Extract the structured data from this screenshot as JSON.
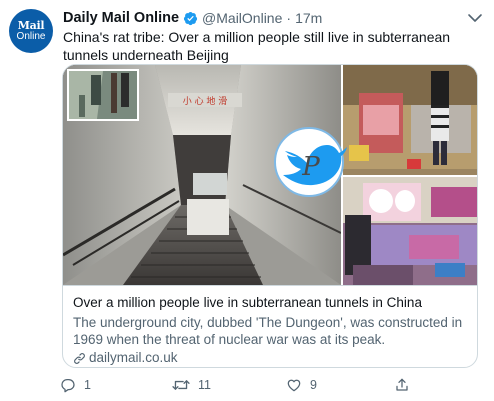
{
  "tweet": {
    "avatar": {
      "line1": "Mail",
      "line2": "Online"
    },
    "author_name": "Daily Mail Online",
    "handle": "@MailOnline",
    "separator": "·",
    "time": "17m",
    "text": "China's rat tribe: Over a million people still live in subterranean tunnels underneath Beijing",
    "sign_text": "小 心 地 滑"
  },
  "card": {
    "title": "Over a million people live in subterranean tunnels in China",
    "description": "The underground city, dubbed 'The Dungeon', was constructed in 1969 when the threat of nuclear war was at its peak.",
    "link": "dailymail.co.uk"
  },
  "actions": {
    "reply_count": "1",
    "retweet_count": "11",
    "like_count": "9"
  },
  "colors": {
    "brand": "#0b5da8",
    "verified": "#1d9bf0",
    "secondary_text": "#536471",
    "border": "#cfd9de"
  }
}
